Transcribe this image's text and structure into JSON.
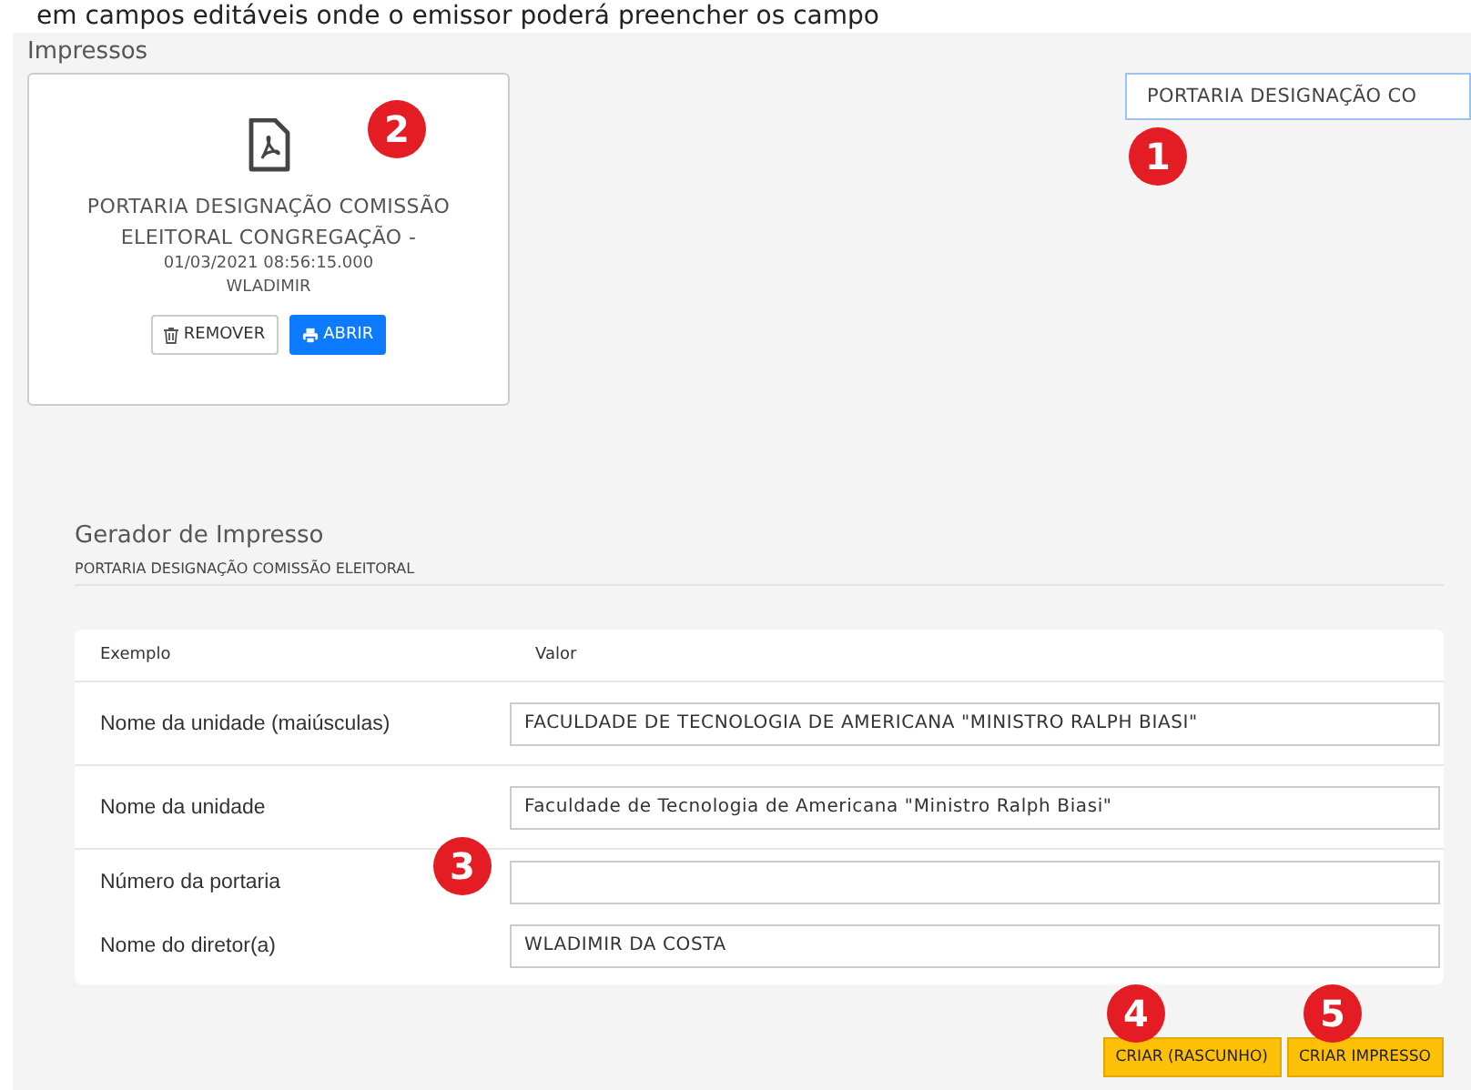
{
  "top_text": "em campos editáveis onde o emissor poderá preencher os campo",
  "section_title": "Impressos",
  "document_select": {
    "value": "PORTARIA DESIGNAÇÃO CO"
  },
  "documents": [
    {
      "title": "PORTARIA DESIGNAÇÃO COMISSÃO ELEITORAL CONGREGAÇÃO -",
      "date": "01/03/2021 08:56:15.000",
      "author": "WLADIMIR",
      "buttons": [
        {
          "kind": "remove",
          "label": "REMOVER"
        },
        {
          "kind": "open",
          "label": "ABRIR"
        }
      ]
    }
  ],
  "generator": {
    "title": "Gerador de Impresso",
    "subtitle": "PORTARIA DESIGNAÇÃO COMISSÃO ELEITORAL",
    "columns": [
      "Exemplo",
      "Valor"
    ],
    "rows": [
      {
        "label": "Nome da unidade (maiúsculas)",
        "value": "FACULDADE DE TECNOLOGIA DE AMERICANA \"MINISTRO RALPH BIASI\""
      },
      {
        "label": "Nome da unidade",
        "value": "Faculdade de Tecnologia de Americana \"Ministro Ralph Biasi\""
      },
      {
        "label": "Número da portaria",
        "value": ""
      },
      {
        "label": "Nome do diretor(a)",
        "value": "WLADIMIR DA COSTA"
      }
    ],
    "buttons": [
      "CRIAR (RASCUNHO)",
      "CRIAR IMPRESSO"
    ]
  },
  "markers": [
    "1",
    "2",
    "3",
    "4",
    "5"
  ]
}
